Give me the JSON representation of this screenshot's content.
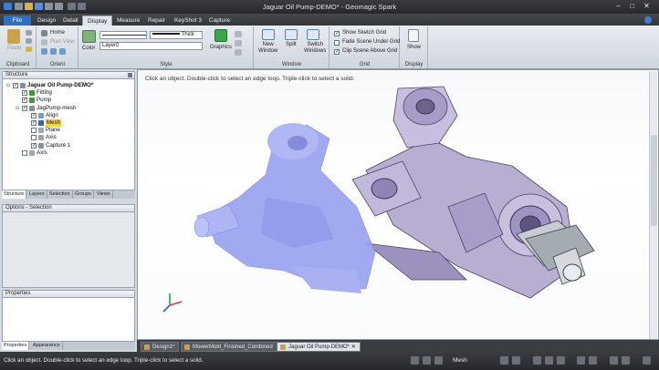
{
  "window": {
    "title": "Jaguar Oil Pump-DEMO* - Geomagic Spark"
  },
  "tabs": [
    "File",
    "Design",
    "Detail",
    "Display",
    "Measure",
    "Repair",
    "KeyShot 3",
    "Capture"
  ],
  "active_tab": "Display",
  "ribbon": {
    "clipboard": {
      "paste_label": "Paste",
      "group_label": "Clipboard"
    },
    "orient": {
      "home_label": "Home",
      "plan_view_label": "Plan View",
      "group_label": "Orient"
    },
    "style": {
      "color_label": "Color",
      "line_weight": "Thick",
      "layer_value": "Layer0",
      "group_label": "Style"
    },
    "graphics_label": "Graphics",
    "window": {
      "new_window_label": "New\nWindow",
      "split_label": "Split",
      "switch_windows_label": "Switch\nWindows",
      "group_label": "Window"
    },
    "grid": {
      "show_sketch_grid": "Show Sketch Grid",
      "fade_scene": "Fade Scene Under Grid",
      "clip_scene": "Clip Scene Above Grid",
      "group_label": "Grid"
    },
    "display": {
      "show_label": "Show",
      "group_label": "Display"
    }
  },
  "structure": {
    "header": "Structure",
    "items": [
      {
        "label": "Jaguar Oil Pump-DEMO*",
        "bold": true,
        "indent": 0,
        "checked": true,
        "icon_color": "#7a8ea8"
      },
      {
        "label": "Fitting",
        "indent": 1,
        "checked": true,
        "icon_color": "#3c9a3c"
      },
      {
        "label": "Pump",
        "indent": 1,
        "checked": true,
        "icon_color": "#3c9a3c"
      },
      {
        "label": "JagPump-mesh",
        "indent": 1,
        "checked": true,
        "icon_color": "#8a8f98"
      },
      {
        "label": "Align",
        "indent": 2,
        "checked": true,
        "icon_color": "#6aa0d6"
      },
      {
        "label": "Mesh",
        "indent": 2,
        "checked": true,
        "icon_color": "#3a5fb0",
        "highlight": true
      },
      {
        "label": "Plane",
        "indent": 2,
        "checked": false,
        "icon_color": "#a0a6ae"
      },
      {
        "label": "Axis",
        "indent": 2,
        "checked": false,
        "icon_color": "#a0a6ae"
      },
      {
        "label": "Capture 1",
        "indent": 2,
        "checked": true,
        "icon_color": "#8a8f98"
      },
      {
        "label": "Axis",
        "indent": 1,
        "checked": false,
        "icon_color": "#a0a6ae"
      }
    ],
    "tabs": [
      "Structure",
      "Layers",
      "Selection",
      "Groups",
      "Views"
    ]
  },
  "options_panel": {
    "header": "Options - Selection"
  },
  "properties_panel": {
    "header": "Properties",
    "tabs": [
      "Properties",
      "Appearance"
    ]
  },
  "viewport": {
    "hint": "Click an object. Double-click to select an edge loop. Triple-click to select a solid."
  },
  "document_tabs": [
    "Design1*",
    "MowerMold_Finished_Combined",
    "Jaguar Oil Pump-DEMO*"
  ],
  "active_document": "Jaguar Oil Pump-DEMO*",
  "status": {
    "text": "Click an object. Double-click to select an edge loop. Triple-click to select a solid.",
    "mode": "Mesh"
  },
  "colors": {
    "mesh": "#9aa3f0",
    "pump": "#b7a8d6",
    "file_tab": "#2f6fbf"
  }
}
